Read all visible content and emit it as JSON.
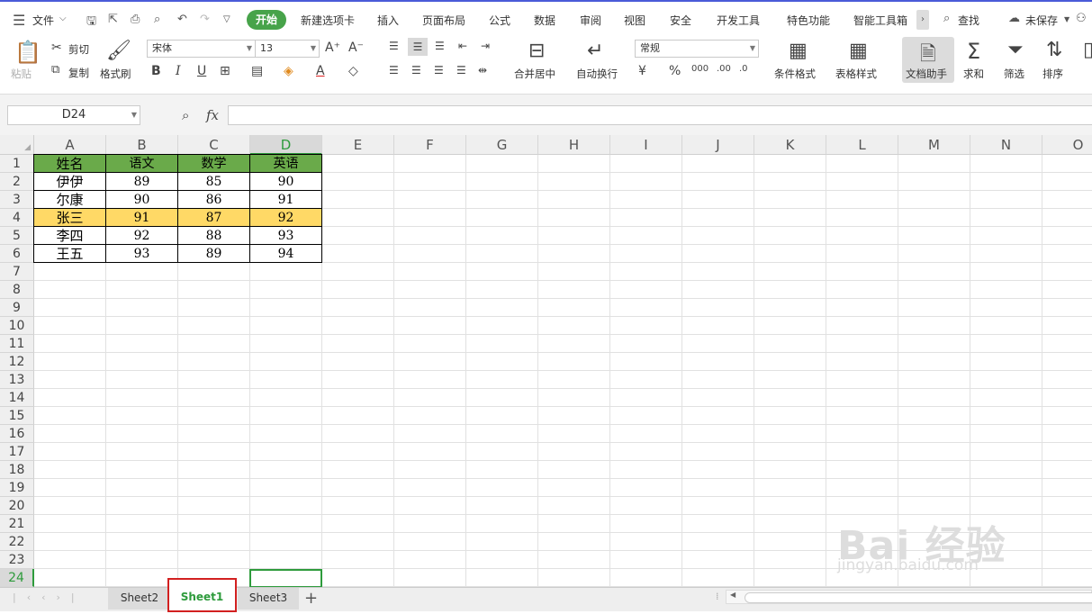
{
  "menu": {
    "file": "文件",
    "start": "开始",
    "items": [
      "新建选项卡",
      "插入",
      "页面布局",
      "公式",
      "数据",
      "审阅",
      "视图",
      "安全",
      "开发工具",
      "特色功能",
      "智能工具箱"
    ],
    "search": "查找",
    "unsaved": "未保存"
  },
  "ribbon": {
    "paste": "粘贴",
    "cut": "剪切",
    "copy": "复制",
    "format_painter": "格式刷",
    "font_name": "宋体",
    "font_size": "13",
    "merge_center": "合并居中",
    "wrap_text": "自动换行",
    "number_format": "常规",
    "conditional_format": "条件格式",
    "table_style": "表格样式",
    "doc_assistant": "文档助手",
    "sum": "求和",
    "filter": "筛选",
    "sort": "排序"
  },
  "formula_bar": {
    "name_box": "D24",
    "fx": "fx"
  },
  "columns": [
    "A",
    "B",
    "C",
    "D",
    "E",
    "F",
    "G",
    "H",
    "I",
    "J",
    "K",
    "L",
    "M",
    "N",
    "O"
  ],
  "rows": [
    "1",
    "2",
    "3",
    "4",
    "5",
    "6",
    "7",
    "8",
    "9",
    "10",
    "11",
    "12",
    "13",
    "14",
    "15",
    "16",
    "17",
    "18",
    "19",
    "20",
    "21",
    "22",
    "23",
    "24"
  ],
  "table": {
    "headers": [
      "姓名",
      "语文",
      "数学",
      "英语"
    ],
    "rows": [
      [
        "伊伊",
        "89",
        "85",
        "90"
      ],
      [
        "尔康",
        "90",
        "86",
        "91"
      ],
      [
        "张三",
        "91",
        "87",
        "92"
      ],
      [
        "李四",
        "92",
        "88",
        "93"
      ],
      [
        "王五",
        "93",
        "89",
        "94"
      ]
    ],
    "highlighted_row": 2
  },
  "colors": {
    "header_fill": "#6aaa4a",
    "highlight_fill": "#ffd966",
    "selection": "#2e9b3c",
    "tab_highlight": "#d22020",
    "accent": "#47a34a"
  },
  "sheets": [
    "Sheet2",
    "Sheet1",
    "Sheet3"
  ],
  "active_sheet": "Sheet1",
  "watermark": {
    "main": "Bai 经验",
    "sub": "jingyan.baidu.com"
  }
}
